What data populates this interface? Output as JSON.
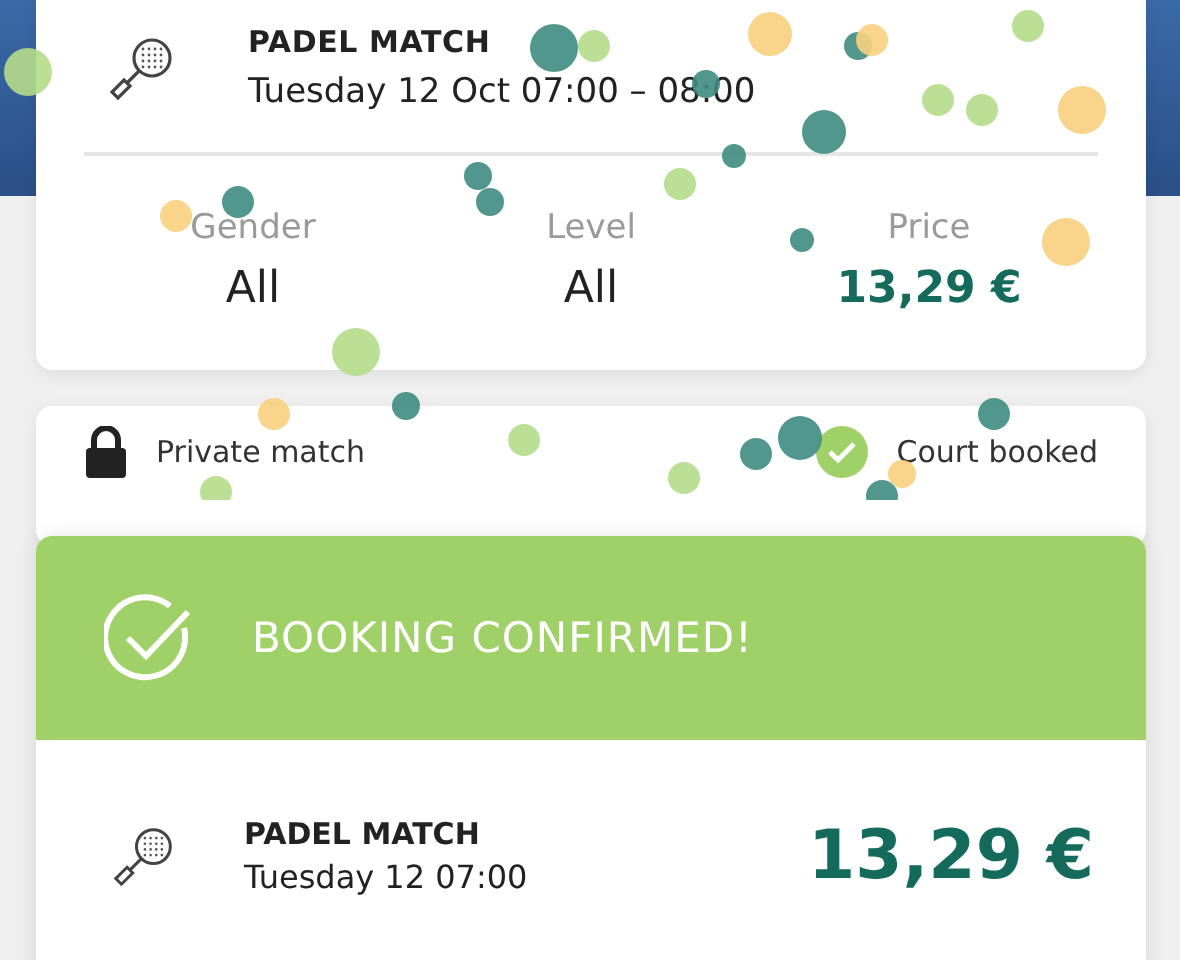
{
  "booking": {
    "title": "PADEL MATCH",
    "datetime": "Tuesday 12 Oct 07:00 – 08:00",
    "details": [
      {
        "label": "Gender",
        "value": "All",
        "kind": "plain"
      },
      {
        "label": "Level",
        "value": "All",
        "kind": "plain"
      },
      {
        "label": "Price",
        "value": "13,29 €",
        "kind": "price"
      }
    ]
  },
  "options": [
    {
      "kind": "lock",
      "label": "Private match"
    },
    {
      "kind": "check",
      "label": "Court booked"
    }
  ],
  "confirmation": {
    "heading": "BOOKING CONFIRMED!",
    "title": "PADEL MATCH",
    "datetime": "Tuesday 12 07:00",
    "price": "13,29 €"
  }
}
